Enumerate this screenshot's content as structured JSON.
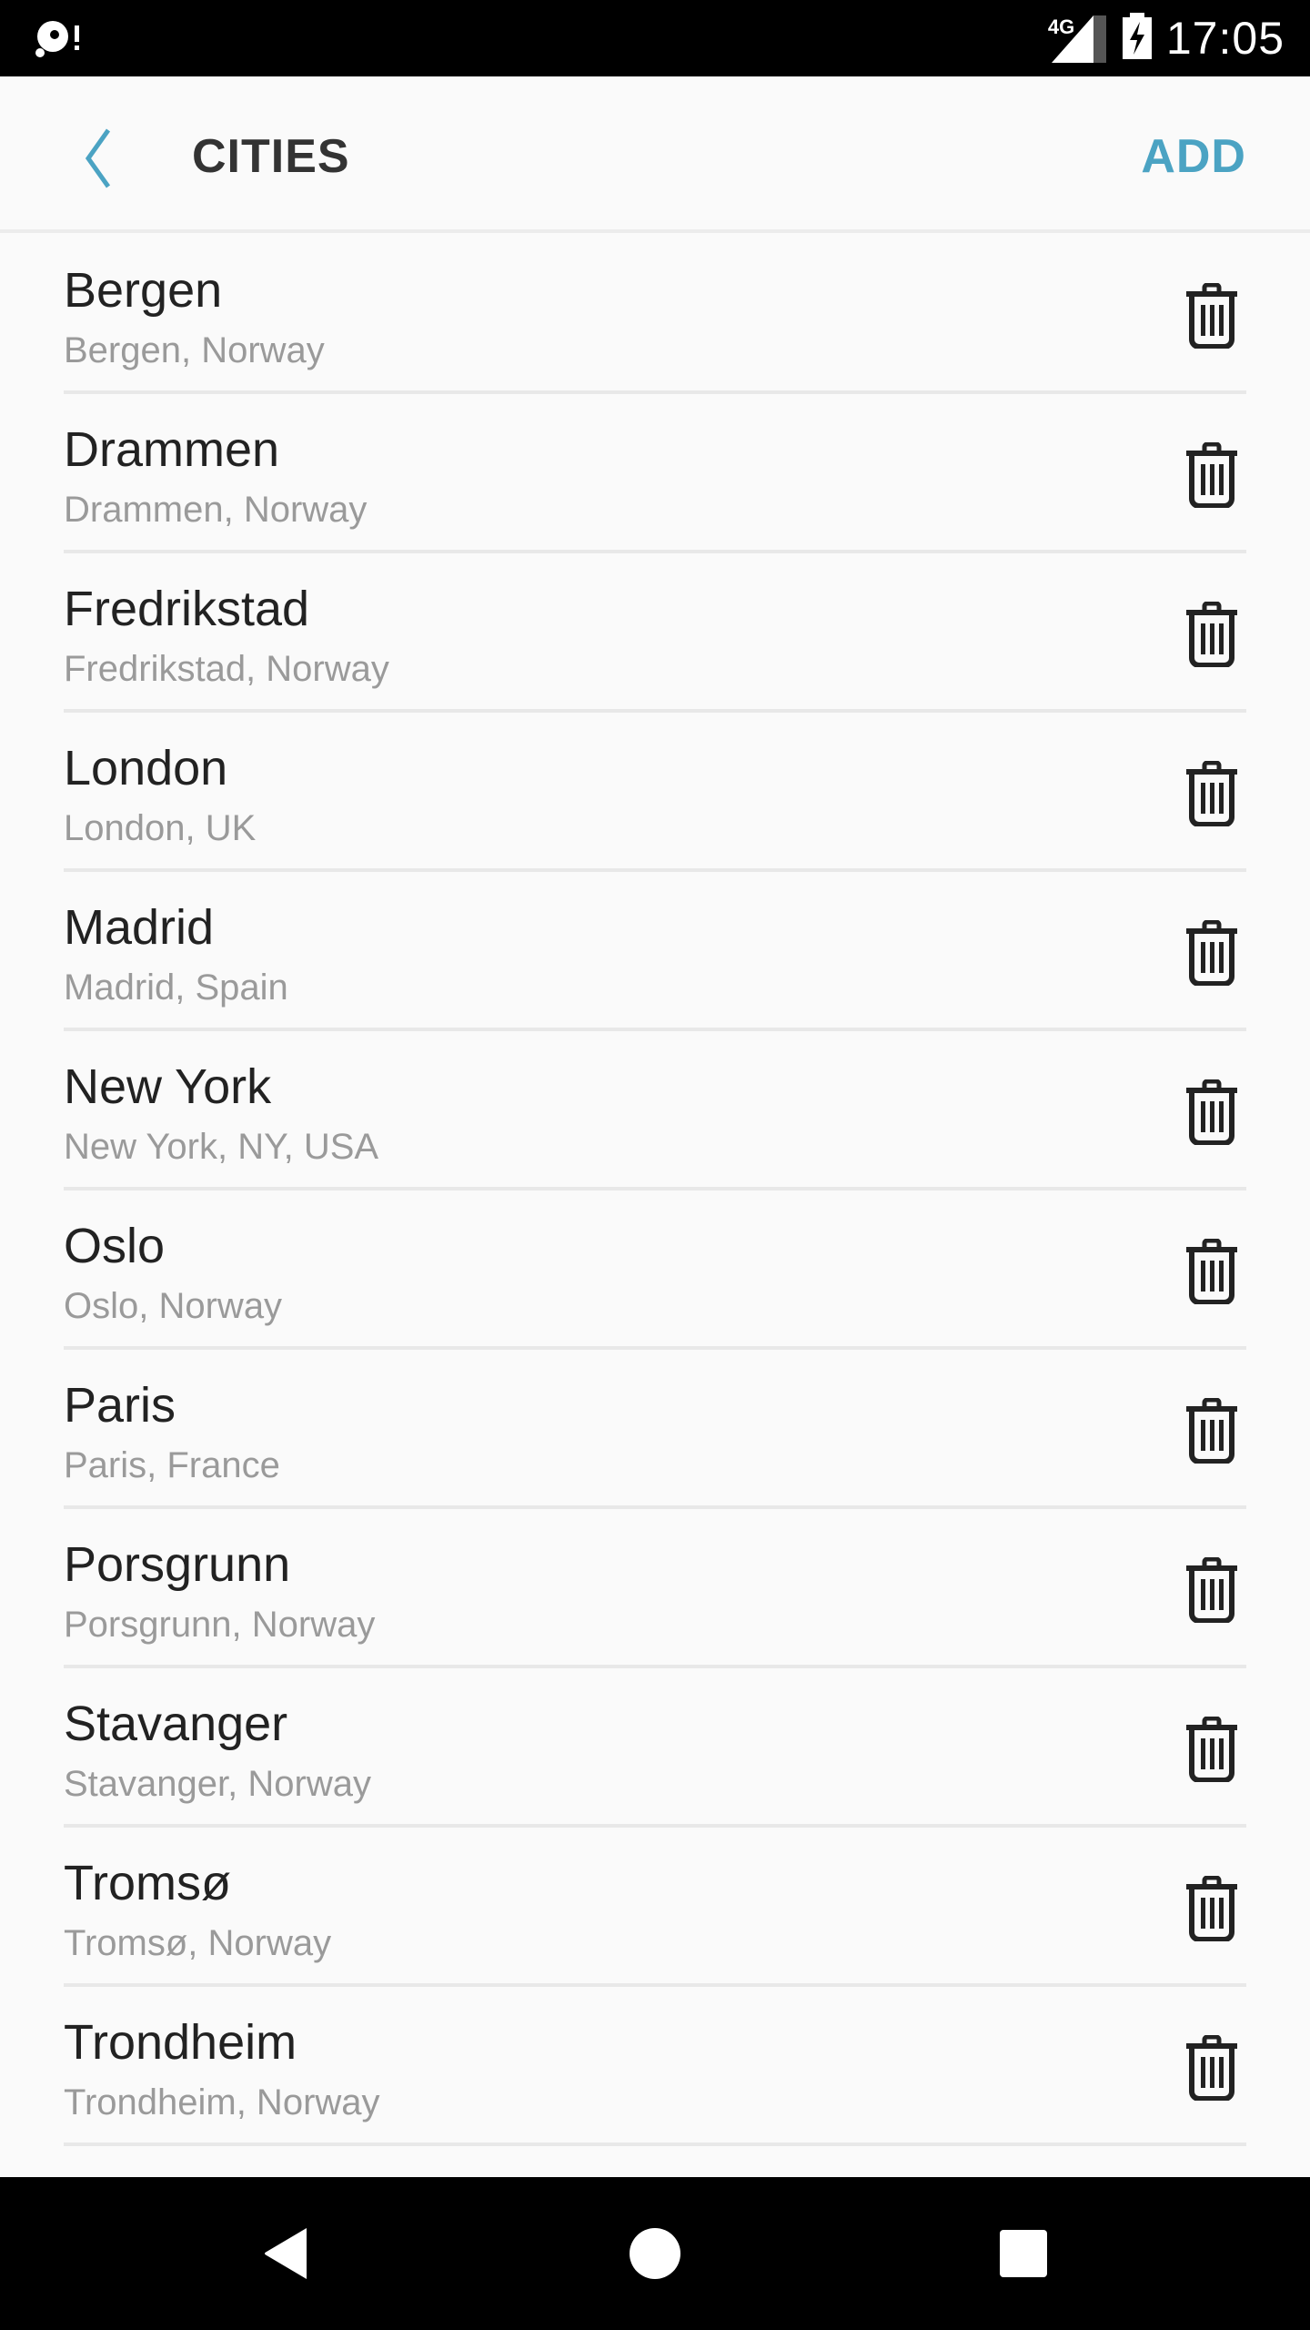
{
  "status_bar": {
    "time": "17:05",
    "network": "4G",
    "icons": [
      "notification-disc-icon",
      "signal-icon",
      "battery-charging-icon"
    ]
  },
  "app_bar": {
    "title": "CITIES",
    "add_label": "ADD",
    "back_icon": "chevron-left-icon",
    "accent_color": "#4ba3c3"
  },
  "cities": [
    {
      "name": "Bergen",
      "detail": "Bergen, Norway"
    },
    {
      "name": "Drammen",
      "detail": "Drammen, Norway"
    },
    {
      "name": "Fredrikstad",
      "detail": "Fredrikstad, Norway"
    },
    {
      "name": "London",
      "detail": "London, UK"
    },
    {
      "name": "Madrid",
      "detail": "Madrid, Spain"
    },
    {
      "name": "New York",
      "detail": "New York, NY, USA"
    },
    {
      "name": "Oslo",
      "detail": "Oslo, Norway"
    },
    {
      "name": "Paris",
      "detail": "Paris, France"
    },
    {
      "name": "Porsgrunn",
      "detail": "Porsgrunn, Norway"
    },
    {
      "name": "Stavanger",
      "detail": "Stavanger, Norway"
    },
    {
      "name": "Tromsø",
      "detail": "Tromsø, Norway"
    },
    {
      "name": "Trondheim",
      "detail": "Trondheim, Norway"
    }
  ],
  "row_action_icon": "trash-icon",
  "nav_bar": {
    "buttons": [
      "back-icon",
      "home-icon",
      "recents-icon"
    ]
  }
}
